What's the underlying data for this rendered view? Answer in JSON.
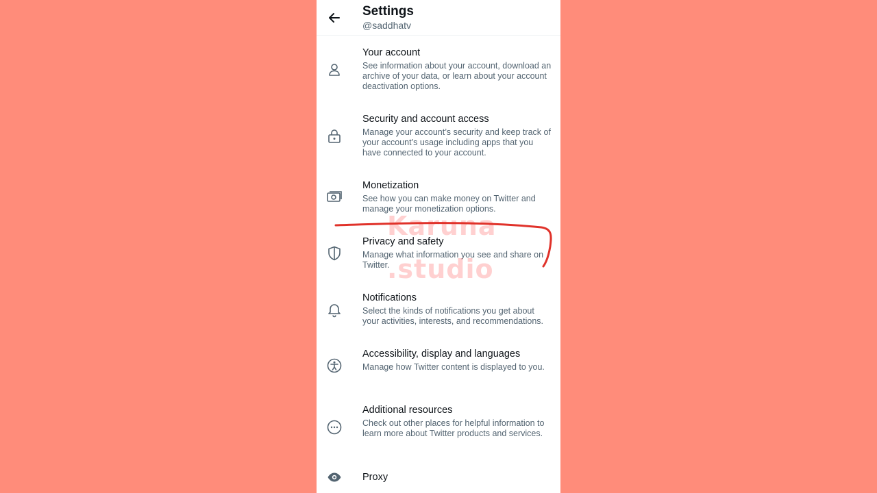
{
  "header": {
    "title": "Settings",
    "handle": "@saddhatv"
  },
  "items": [
    {
      "label": "Your account",
      "description": "See information about your account, download an archive of your data, or learn about your account deactivation options.",
      "icon": "person-icon"
    },
    {
      "label": "Security and account access",
      "description": "Manage your account’s security and keep track of your account’s usage including apps that you have connected to your account.",
      "icon": "lock-icon"
    },
    {
      "label": "Monetization",
      "description": "See how you can make money on Twitter and manage your monetization options.",
      "icon": "money-icon"
    },
    {
      "label": "Privacy and safety",
      "description": "Manage what information you see and share on Twitter.",
      "icon": "shield-icon"
    },
    {
      "label": "Notifications",
      "description": "Select the kinds of notifications you get about your activities, interests, and recommendations.",
      "icon": "bell-icon"
    },
    {
      "label": "Accessibility, display and languages",
      "description": "Manage how Twitter content is displayed to you.",
      "icon": "accessibility-icon"
    },
    {
      "label": "Additional resources",
      "description": "Check out other places for helpful information to learn more about Twitter products and services.",
      "icon": "more-icon"
    },
    {
      "label": "Proxy",
      "description": "",
      "icon": "eye-icon"
    }
  ],
  "watermark": {
    "line1": "Karuna",
    "line2": ".studio"
  },
  "colors": {
    "background": "#ff8c7a",
    "annotation": "#e0322a",
    "text_primary": "#0f1419",
    "text_secondary": "#536471"
  }
}
